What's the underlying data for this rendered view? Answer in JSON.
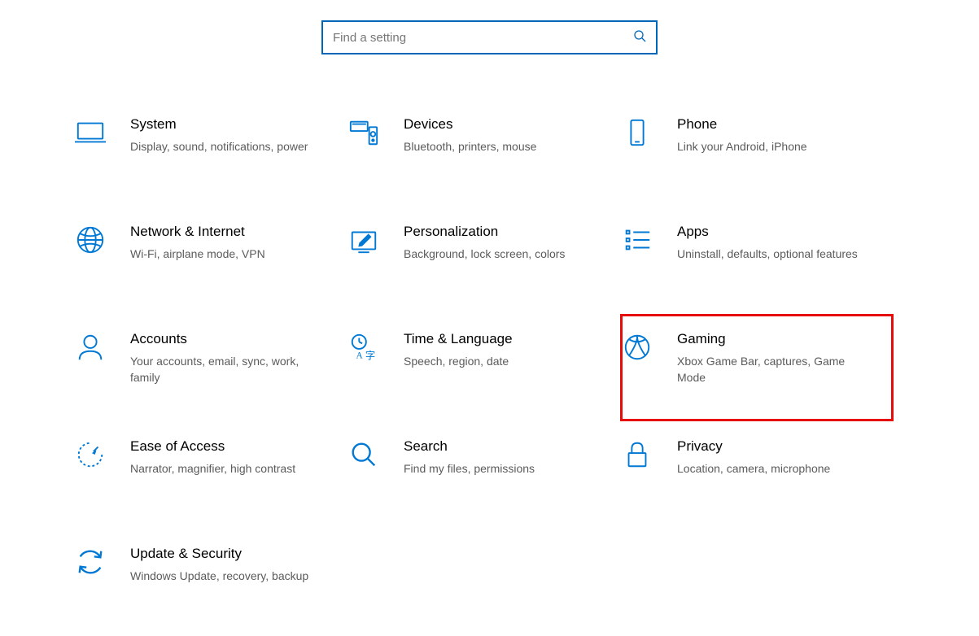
{
  "search": {
    "placeholder": "Find a setting",
    "value": ""
  },
  "highlight": "gaming",
  "categories": [
    {
      "id": "system",
      "title": "System",
      "description": "Display, sound, notifications, power"
    },
    {
      "id": "devices",
      "title": "Devices",
      "description": "Bluetooth, printers, mouse"
    },
    {
      "id": "phone",
      "title": "Phone",
      "description": "Link your Android, iPhone"
    },
    {
      "id": "network",
      "title": "Network & Internet",
      "description": "Wi-Fi, airplane mode, VPN"
    },
    {
      "id": "personalization",
      "title": "Personalization",
      "description": "Background, lock screen, colors"
    },
    {
      "id": "apps",
      "title": "Apps",
      "description": "Uninstall, defaults, optional features"
    },
    {
      "id": "accounts",
      "title": "Accounts",
      "description": "Your accounts, email, sync, work, family"
    },
    {
      "id": "time-language",
      "title": "Time & Language",
      "description": "Speech, region, date"
    },
    {
      "id": "gaming",
      "title": "Gaming",
      "description": "Xbox Game Bar, captures, Game Mode"
    },
    {
      "id": "ease-of-access",
      "title": "Ease of Access",
      "description": "Narrator, magnifier, high contrast"
    },
    {
      "id": "search",
      "title": "Search",
      "description": "Find my files, permissions"
    },
    {
      "id": "privacy",
      "title": "Privacy",
      "description": "Location, camera, microphone"
    },
    {
      "id": "update-security",
      "title": "Update & Security",
      "description": "Windows Update, recovery, backup"
    }
  ]
}
